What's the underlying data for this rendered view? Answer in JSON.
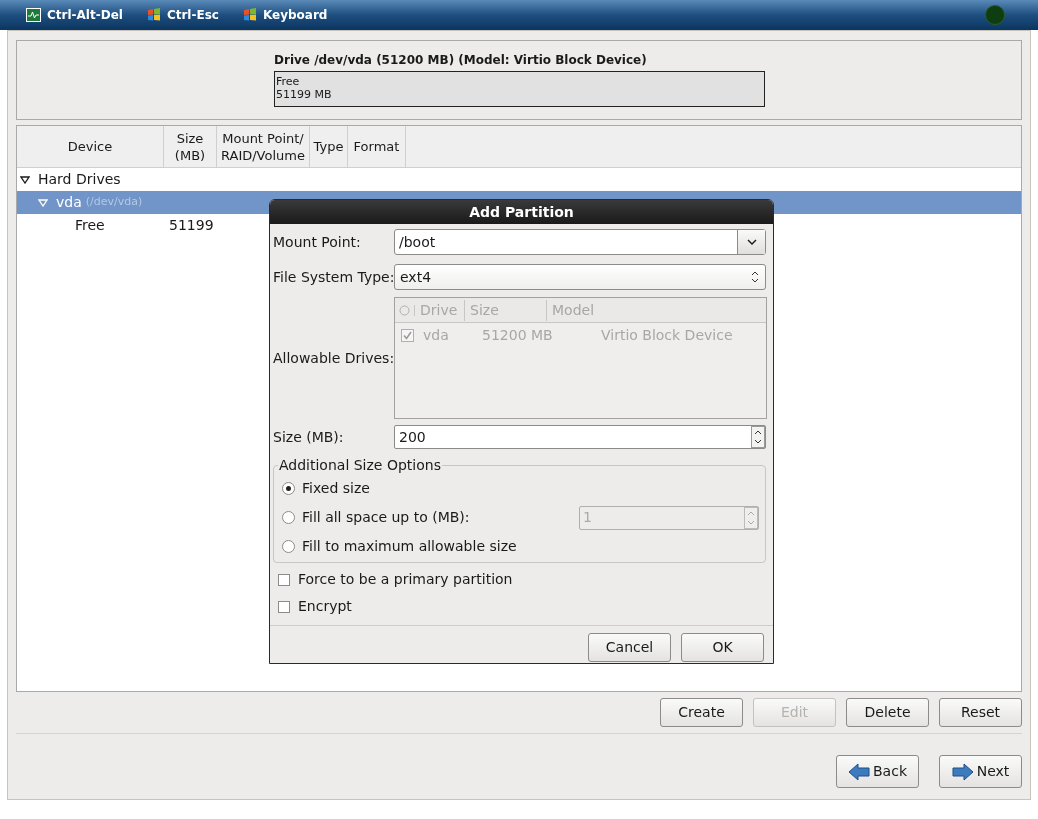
{
  "toolbar": {
    "items": [
      {
        "label": "Ctrl-Alt-Del",
        "kind": "monitor"
      },
      {
        "label": "Ctrl-Esc",
        "kind": "flag"
      },
      {
        "label": "Keyboard",
        "kind": "flag"
      }
    ]
  },
  "drive": {
    "title": "Drive /dev/vda (51200 MB) (Model: Virtio Block Device)",
    "segments": [
      {
        "label": "Free",
        "size": "51199 MB"
      }
    ]
  },
  "table": {
    "columns": [
      "Device",
      "Size\n(MB)",
      "Mount Point/\nRAID/Volume",
      "Type",
      "Format"
    ],
    "rows": [
      {
        "label": "Hard Drives",
        "expanded": true,
        "selected": false,
        "children": [
          {
            "label": "vda",
            "detail": "(/dev/vda)",
            "expanded": true,
            "selected": true,
            "children": [
              {
                "label": "Free",
                "size": "51199",
                "selected": false
              }
            ]
          }
        ]
      }
    ]
  },
  "actions": [
    {
      "label": "Create",
      "disabled": false
    },
    {
      "label": "Edit",
      "disabled": true
    },
    {
      "label": "Delete",
      "disabled": false
    },
    {
      "label": "Reset",
      "disabled": false
    }
  ],
  "navigation": [
    {
      "label": "Back",
      "kind": "back"
    },
    {
      "label": "Next",
      "kind": "next"
    }
  ],
  "dialog": {
    "title": "Add Partition",
    "mount_point": {
      "label": "Mount Point:",
      "value": "/boot"
    },
    "file_system_type": {
      "label": "File System Type:",
      "value": "ext4"
    },
    "allowable_drives": {
      "label": "Allowable Drives:",
      "columns": [
        "Drive",
        "Size",
        "Model"
      ],
      "rows": [
        {
          "checked": true,
          "drive": "vda",
          "size": "51200 MB",
          "model": "Virtio Block Device"
        }
      ]
    },
    "size": {
      "label": "Size (MB):",
      "value": "200"
    },
    "size_options": {
      "title": "Additional Size Options",
      "options": [
        {
          "label": "Fixed size",
          "selected": true
        },
        {
          "label": "Fill all space up to (MB):",
          "selected": false,
          "value": "1"
        },
        {
          "label": "Fill to maximum allowable size",
          "selected": false
        }
      ]
    },
    "checkboxes": [
      {
        "label": "Force to be a primary partition",
        "checked": false
      },
      {
        "label": "Encrypt",
        "checked": false
      }
    ],
    "buttons": [
      "Cancel",
      "OK"
    ]
  }
}
